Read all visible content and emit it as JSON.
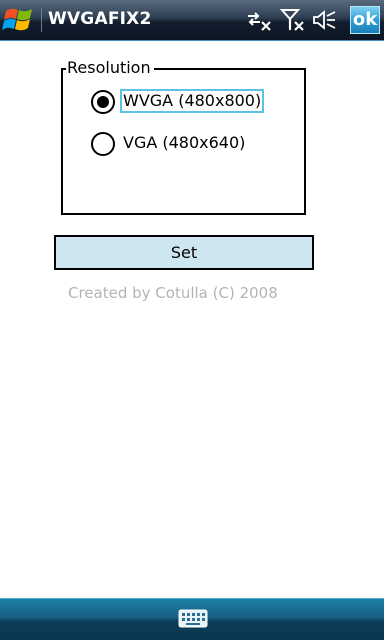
{
  "title_bar": {
    "title": "WVGAFIX2",
    "ok_label": "ok"
  },
  "status_icons": [
    "connectivity-off-icon",
    "signal-off-icon",
    "speaker-muted-icon"
  ],
  "resolution_group": {
    "legend": "Resolution",
    "options": [
      {
        "label": "WVGA (480x800)",
        "selected": true
      },
      {
        "label": "VGA (480x640)",
        "selected": false
      }
    ]
  },
  "set_button": {
    "label": "Set"
  },
  "credits": "Created by Cotulla (C) 2008",
  "colors": {
    "title_bar": "#1e2c3e",
    "ok_button": "#2f9fd6",
    "set_button_bg": "#cde6ef",
    "focus_outline": "#5bc4e6",
    "credits_text": "#b4b4b4",
    "bottom_bar": "#155f80"
  },
  "bottom_bar": {
    "icon": "keyboard-icon"
  }
}
